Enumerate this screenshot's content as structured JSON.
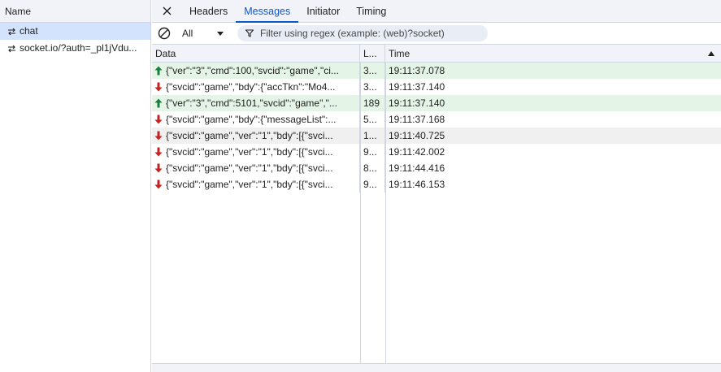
{
  "left": {
    "header": "Name",
    "items": [
      {
        "label": "chat",
        "icon": "websocket-icon",
        "selected": true
      },
      {
        "label": "socket.io/?auth=_pl1jVdu...",
        "icon": "websocket-icon",
        "selected": false
      }
    ]
  },
  "tabs": [
    {
      "label": "Headers",
      "active": false
    },
    {
      "label": "Messages",
      "active": true
    },
    {
      "label": "Initiator",
      "active": false
    },
    {
      "label": "Timing",
      "active": false
    }
  ],
  "toolbar": {
    "select_value": "All",
    "filter_placeholder": "Filter using regex (example: (web)?socket)"
  },
  "table": {
    "headers": {
      "data": "Data",
      "length": "L...",
      "time": "Time"
    },
    "rows": [
      {
        "direction": "sent",
        "data": "{\"ver\":\"3\",\"cmd\":100,\"svcid\":\"game\",\"ci...",
        "length": "3...",
        "time": "19:11:37.078"
      },
      {
        "direction": "received",
        "data": "{\"svcid\":\"game\",\"bdy\":{\"accTkn\":\"Mo4...",
        "length": "3...",
        "time": "19:11:37.140"
      },
      {
        "direction": "sent",
        "data": "{\"ver\":\"3\",\"cmd\":5101,\"svcid\":\"game\",\"...",
        "length": "189",
        "time": "19:11:37.140"
      },
      {
        "direction": "received",
        "data": "{\"svcid\":\"game\",\"bdy\":{\"messageList\":...",
        "length": "5...",
        "time": "19:11:37.168"
      },
      {
        "direction": "received",
        "data": "{\"svcid\":\"game\",\"ver\":\"1\",\"bdy\":[{\"svci...",
        "length": "1...",
        "time": "19:11:40.725",
        "hovered": true
      },
      {
        "direction": "received",
        "data": "{\"svcid\":\"game\",\"ver\":\"1\",\"bdy\":[{\"svci...",
        "length": "9...",
        "time": "19:11:42.002"
      },
      {
        "direction": "received",
        "data": "{\"svcid\":\"game\",\"ver\":\"1\",\"bdy\":[{\"svci...",
        "length": "8...",
        "time": "19:11:44.416"
      },
      {
        "direction": "received",
        "data": "{\"svcid\":\"game\",\"ver\":\"1\",\"bdy\":[{\"svci...",
        "length": "9...",
        "time": "19:11:46.153"
      }
    ]
  },
  "colors": {
    "accent": "#0b57d0",
    "sent_row": "#e4f4e6",
    "sent_arrow": "#188038",
    "received_arrow": "#c5221f",
    "selected_item": "#d3e3fd"
  }
}
